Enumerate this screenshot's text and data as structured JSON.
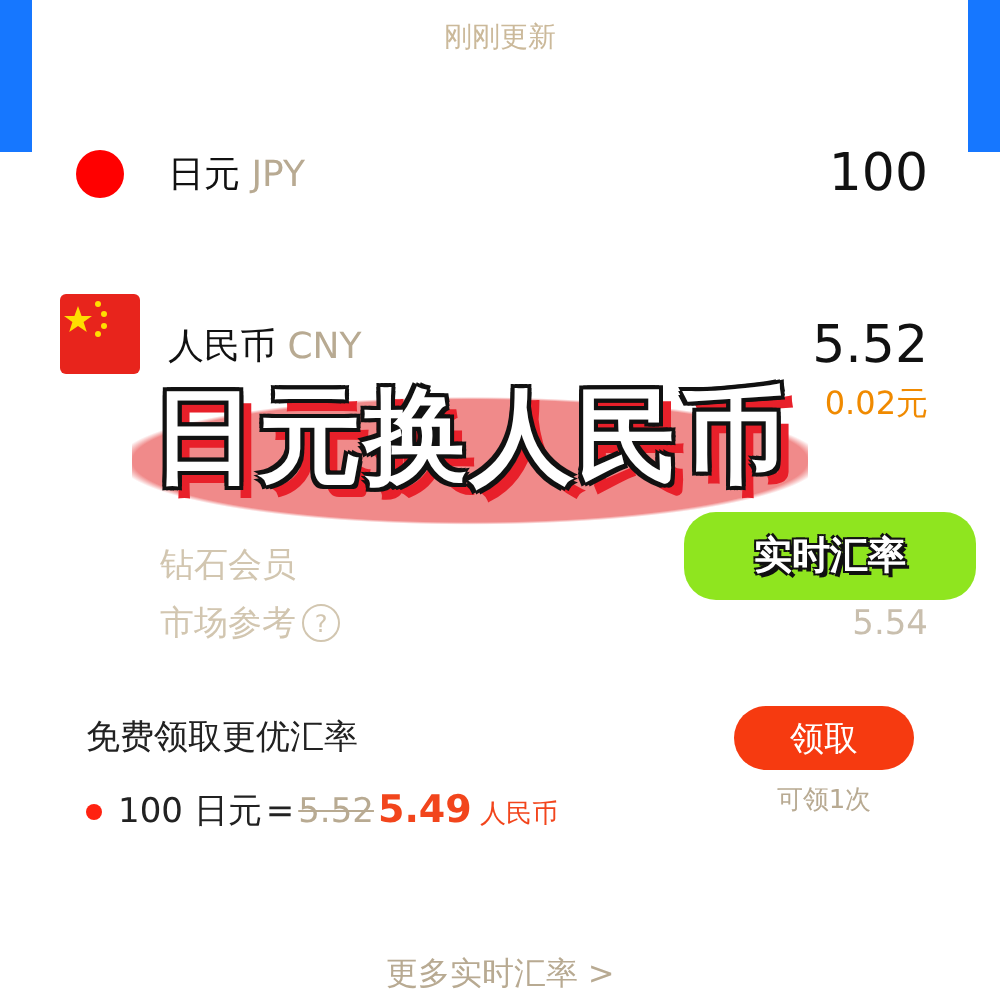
{
  "status": {
    "text": "刚刚更新"
  },
  "currencies": [
    {
      "name": "日元",
      "code": "JPY",
      "amount": "100",
      "kind": "jp"
    },
    {
      "name": "人民币",
      "code": "CNY",
      "amount": "5.52",
      "kind": "cn",
      "change": "0.02元"
    }
  ],
  "references": [
    {
      "label": "钻石会员"
    },
    {
      "label": "市场参考",
      "help": "?",
      "value": "5.54"
    }
  ],
  "promo": {
    "title": "免费领取更优汇率",
    "amount": "100 日元",
    "equals": "=",
    "old_rate": "5.52",
    "new_rate": "5.49",
    "target": "人民币",
    "button": "领取",
    "limit": "可领1次"
  },
  "more_link": "更多实时汇率 >",
  "overlay": {
    "title": "日元换人民币",
    "bubble": "实时汇率"
  }
}
